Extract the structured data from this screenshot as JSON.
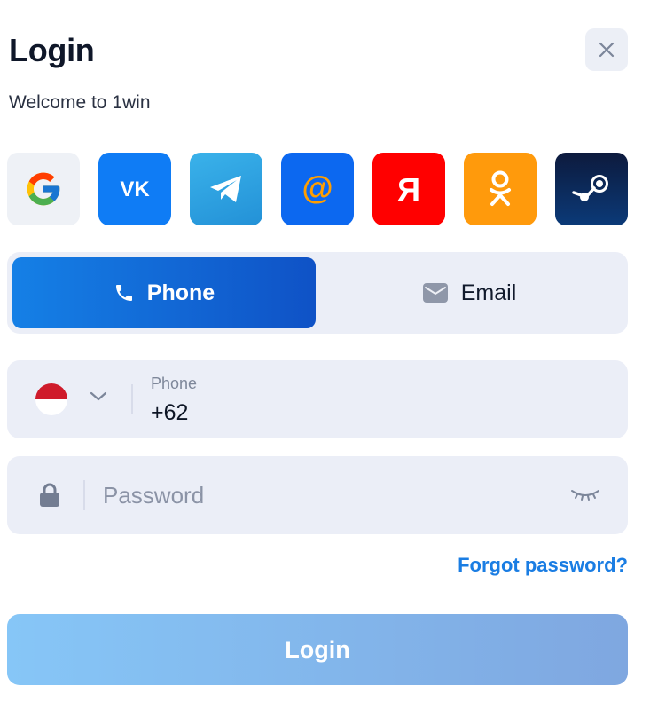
{
  "header": {
    "title": "Login",
    "subtitle": "Welcome to 1win",
    "close_icon": "close-icon"
  },
  "social_logins": [
    {
      "name": "Google",
      "icon": "google-icon",
      "color": "#eef1f6"
    },
    {
      "name": "VK",
      "icon": "vk-icon",
      "label": "VK",
      "color": "#0f7cf5"
    },
    {
      "name": "Telegram",
      "icon": "telegram-icon",
      "color": "#2aa3e0"
    },
    {
      "name": "Mail.ru",
      "icon": "at-sign-icon",
      "label": "@",
      "color": "#0c68f0"
    },
    {
      "name": "Yandex",
      "icon": "yandex-icon",
      "label": "Я",
      "color": "#ff0000"
    },
    {
      "name": "Odnoklassniki",
      "icon": "odnoklassniki-icon",
      "color": "#ff9a0c"
    },
    {
      "name": "Steam",
      "icon": "steam-icon",
      "color": "#0d1a3d"
    }
  ],
  "tabs": {
    "phone_label": "Phone",
    "email_label": "Email",
    "active": "Phone"
  },
  "phone_field": {
    "label": "Phone",
    "value": "+62",
    "country_flag": "indonesia-flag"
  },
  "password_field": {
    "placeholder": "Password",
    "value": ""
  },
  "forgot_password": "Forgot password?",
  "submit": {
    "label": "Login"
  },
  "colors": {
    "accent": "#0f52c6",
    "link": "#1a7de3",
    "field_bg": "#ebeef7"
  }
}
